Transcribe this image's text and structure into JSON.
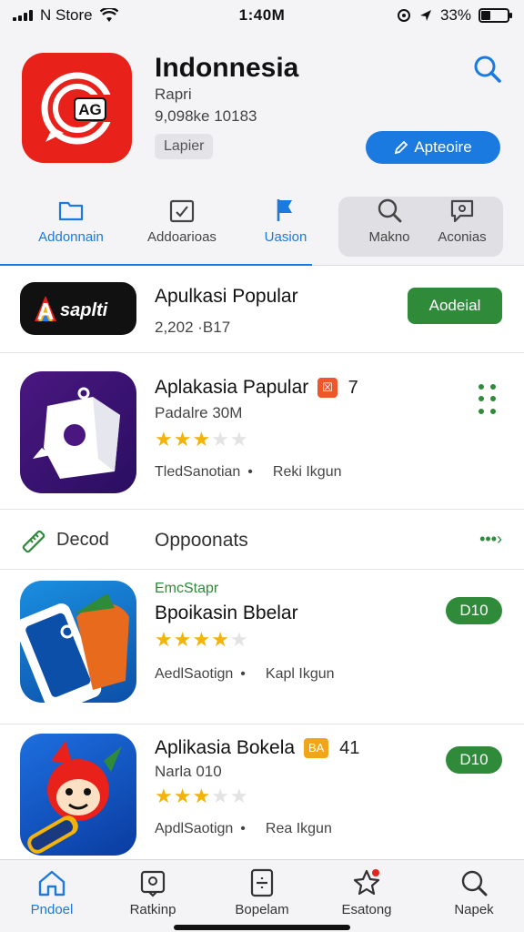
{
  "status": {
    "carrier": "N Store",
    "time": "1:40M",
    "battery": "33%",
    "battery_level": 0.33
  },
  "header": {
    "app_title": "Indonnesia",
    "subtitle": "Rapri",
    "meta": "9,098ke 10183",
    "chip": "Lapier",
    "primary_button": "Apteoire",
    "icon_text": "AG"
  },
  "tabs": [
    {
      "label": "Addonnain",
      "icon": "folder-icon"
    },
    {
      "label": "Addoarioas",
      "icon": "calendar-check-icon"
    },
    {
      "label": "Uasion",
      "icon": "flag-icon"
    },
    {
      "label": "Makno",
      "icon": "search-icon"
    },
    {
      "label": "Aconias",
      "icon": "chat-icon"
    }
  ],
  "rows": [
    {
      "title": "Apulkasi Popular",
      "meta": "2,202 ·B17",
      "button": "Aodeial",
      "logo_text": "saplti",
      "logo_letter": "A"
    },
    {
      "title": "Aplakasia Papular",
      "badge": "☒",
      "badge_color": "#f0562b",
      "badge_num": "7",
      "sub": "Padalre 30M",
      "rating": 3,
      "max_rating": 5,
      "foot_left": "TledSanotian",
      "foot_right": "Reki Ikgun"
    }
  ],
  "section": {
    "label": "Decod",
    "title": "Oppoonats",
    "more": "•••›"
  },
  "featured": [
    {
      "tag": "EmcStapr",
      "title": "Bpoikasin Bbelar",
      "rating": 4,
      "max_rating": 5,
      "foot_left": "AedlSaotign",
      "foot_right": "Kapl Ikgun",
      "button": "D10"
    },
    {
      "title": "Aplikasia Bokela",
      "badge": "BA",
      "badge_color": "#f2a51a",
      "badge_num": "41",
      "sub": "Narla 010",
      "rating": 2.5,
      "max_rating": 5,
      "foot_left": "ApdlSaotign",
      "foot_right": "Rea Ikgun",
      "button": "D10"
    }
  ],
  "bottom_tabs": [
    {
      "label": "Pndoel",
      "icon": "home-icon"
    },
    {
      "label": "Ratkinp",
      "icon": "ranking-icon"
    },
    {
      "label": "Bopelam",
      "icon": "updates-icon"
    },
    {
      "label": "Esatong",
      "icon": "star-notification-icon"
    },
    {
      "label": "Napek",
      "icon": "search-icon"
    }
  ],
  "colors": {
    "accent": "#1a7ae0",
    "green": "#2f8a3a",
    "red_icon": "#e8221b",
    "star": "#f2b30b"
  }
}
